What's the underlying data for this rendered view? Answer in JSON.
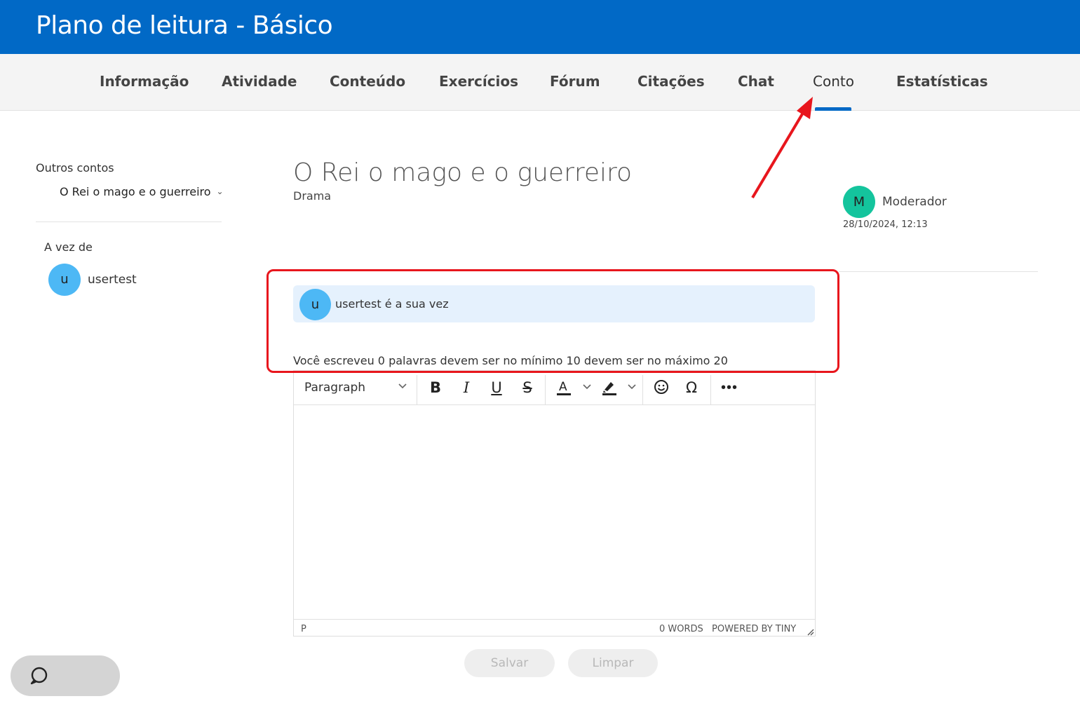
{
  "header": {
    "title": "Plano de leitura - Básico"
  },
  "tabs": [
    {
      "label": "Informação"
    },
    {
      "label": "Atividade"
    },
    {
      "label": "Conteúdo"
    },
    {
      "label": "Exercícios"
    },
    {
      "label": "Fórum"
    },
    {
      "label": "Citações"
    },
    {
      "label": "Chat"
    },
    {
      "label": "Conto",
      "active": true
    },
    {
      "label": "Estatísticas"
    }
  ],
  "sidebar": {
    "other_stories_label": "Outros contos",
    "selected_story": "O Rei o mago e o guerreiro",
    "turn_label": "A vez de",
    "turn_user_initial": "u",
    "turn_user_name": "usertest"
  },
  "story": {
    "title": "O Rei o mago e o guerreiro",
    "genre": "Drama",
    "author_initial": "M",
    "author_name": "Moderador",
    "date": "28/10/2024, 12:13"
  },
  "turn_notice": {
    "initial": "u",
    "text": "usertest é a sua vez"
  },
  "word_info": "Você escreveu 0 palavras devem ser no mínimo 10 devem ser no máximo 20",
  "editor": {
    "block_format": "Paragraph",
    "status_path": "P",
    "word_count": "0 WORDS",
    "powered_by": "POWERED BY TINY",
    "toolbar_icons": [
      "bold-icon",
      "italic-icon",
      "underline-icon",
      "strikethrough-icon",
      "text-color-icon",
      "highlight-icon",
      "emoji-icon",
      "special-char-icon",
      "more-icon"
    ]
  },
  "actions": {
    "save_label": "Salvar",
    "clear_label": "Limpar"
  },
  "colors": {
    "brand_blue": "#0169c6",
    "annotation_red": "#e8161d",
    "avatar_user": "#4db8f5",
    "avatar_moderator": "#14c49d",
    "turn_bg": "#e5f1fd"
  }
}
